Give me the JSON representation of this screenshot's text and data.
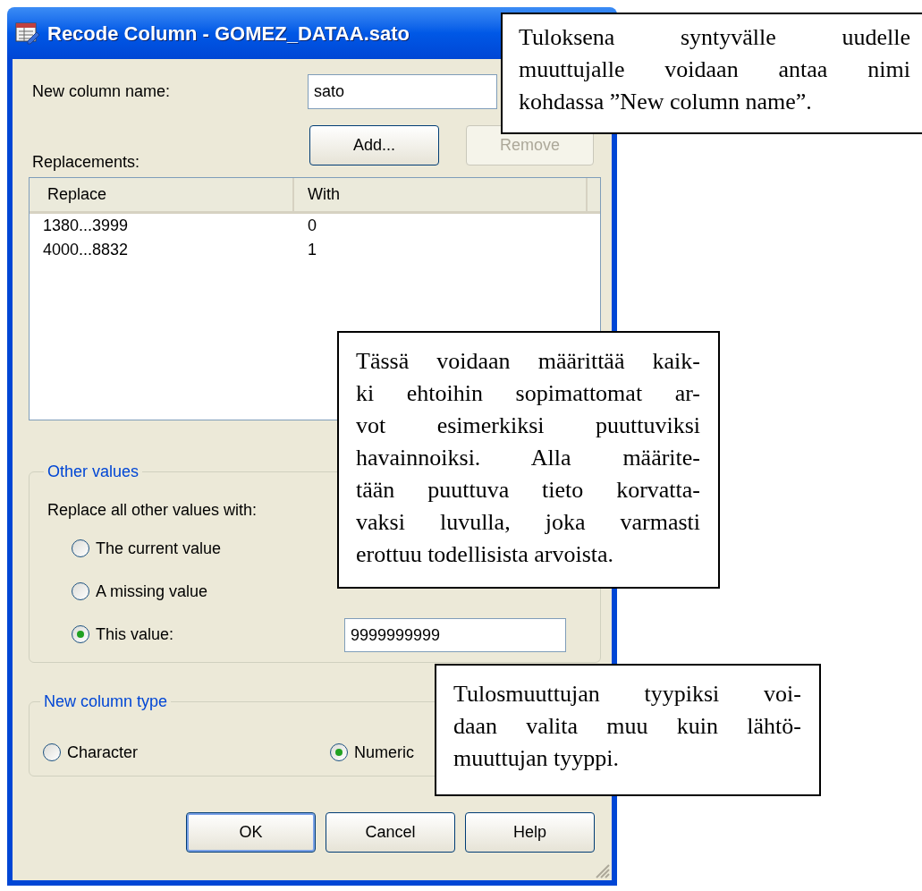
{
  "window": {
    "title": "Recode Column - GOMEZ_DATAA.sato"
  },
  "new_column_name": {
    "label": "New column name:",
    "value": "sato"
  },
  "replacements": {
    "label": "Replacements:",
    "buttons": [
      {
        "label": "Add...",
        "disabled": false
      },
      {
        "label": "Remove",
        "disabled": true
      }
    ],
    "columns": [
      "Replace",
      "With"
    ],
    "rows": [
      [
        "1380...3999",
        "0"
      ],
      [
        "4000...8832",
        "1"
      ]
    ]
  },
  "other_values": {
    "title": "Other values",
    "prompt": "Replace all other values with:",
    "options": [
      {
        "label": "The current value",
        "selected": false
      },
      {
        "label": "A missing value",
        "selected": false
      },
      {
        "label": "This value:",
        "selected": true
      }
    ],
    "this_value": "9999999999"
  },
  "new_column_type": {
    "title": "New column type",
    "options": [
      {
        "label": "Character",
        "selected": false
      },
      {
        "label": "Numeric",
        "selected": true
      }
    ]
  },
  "buttons": [
    {
      "label": "OK",
      "default": true
    },
    {
      "label": "Cancel",
      "default": false
    },
    {
      "label": "Help",
      "default": false
    }
  ],
  "callouts": [
    {
      "lines": [
        "Tuloksena syntyvälle uudelle",
        "muuttujalle voidaan antaa nimi",
        "kohdassa ”New column name”."
      ]
    },
    {
      "lines": [
        "Tässä voidaan määrittää kaik-",
        "ki ehtoihin sopimattomat ar-",
        "vot esimerkiksi puuttuviksi",
        "havainnoiksi. Alla määrite-",
        "tään puuttuva tieto korvatta-",
        "vaksi luvulla, joka varmasti",
        "erottuu todellisista arvoista."
      ]
    },
    {
      "lines": [
        "Tulosmuuttujan tyypiksi voi-",
        "daan valita muu kuin lähtö-",
        "muuttujan tyyppi."
      ]
    }
  ]
}
